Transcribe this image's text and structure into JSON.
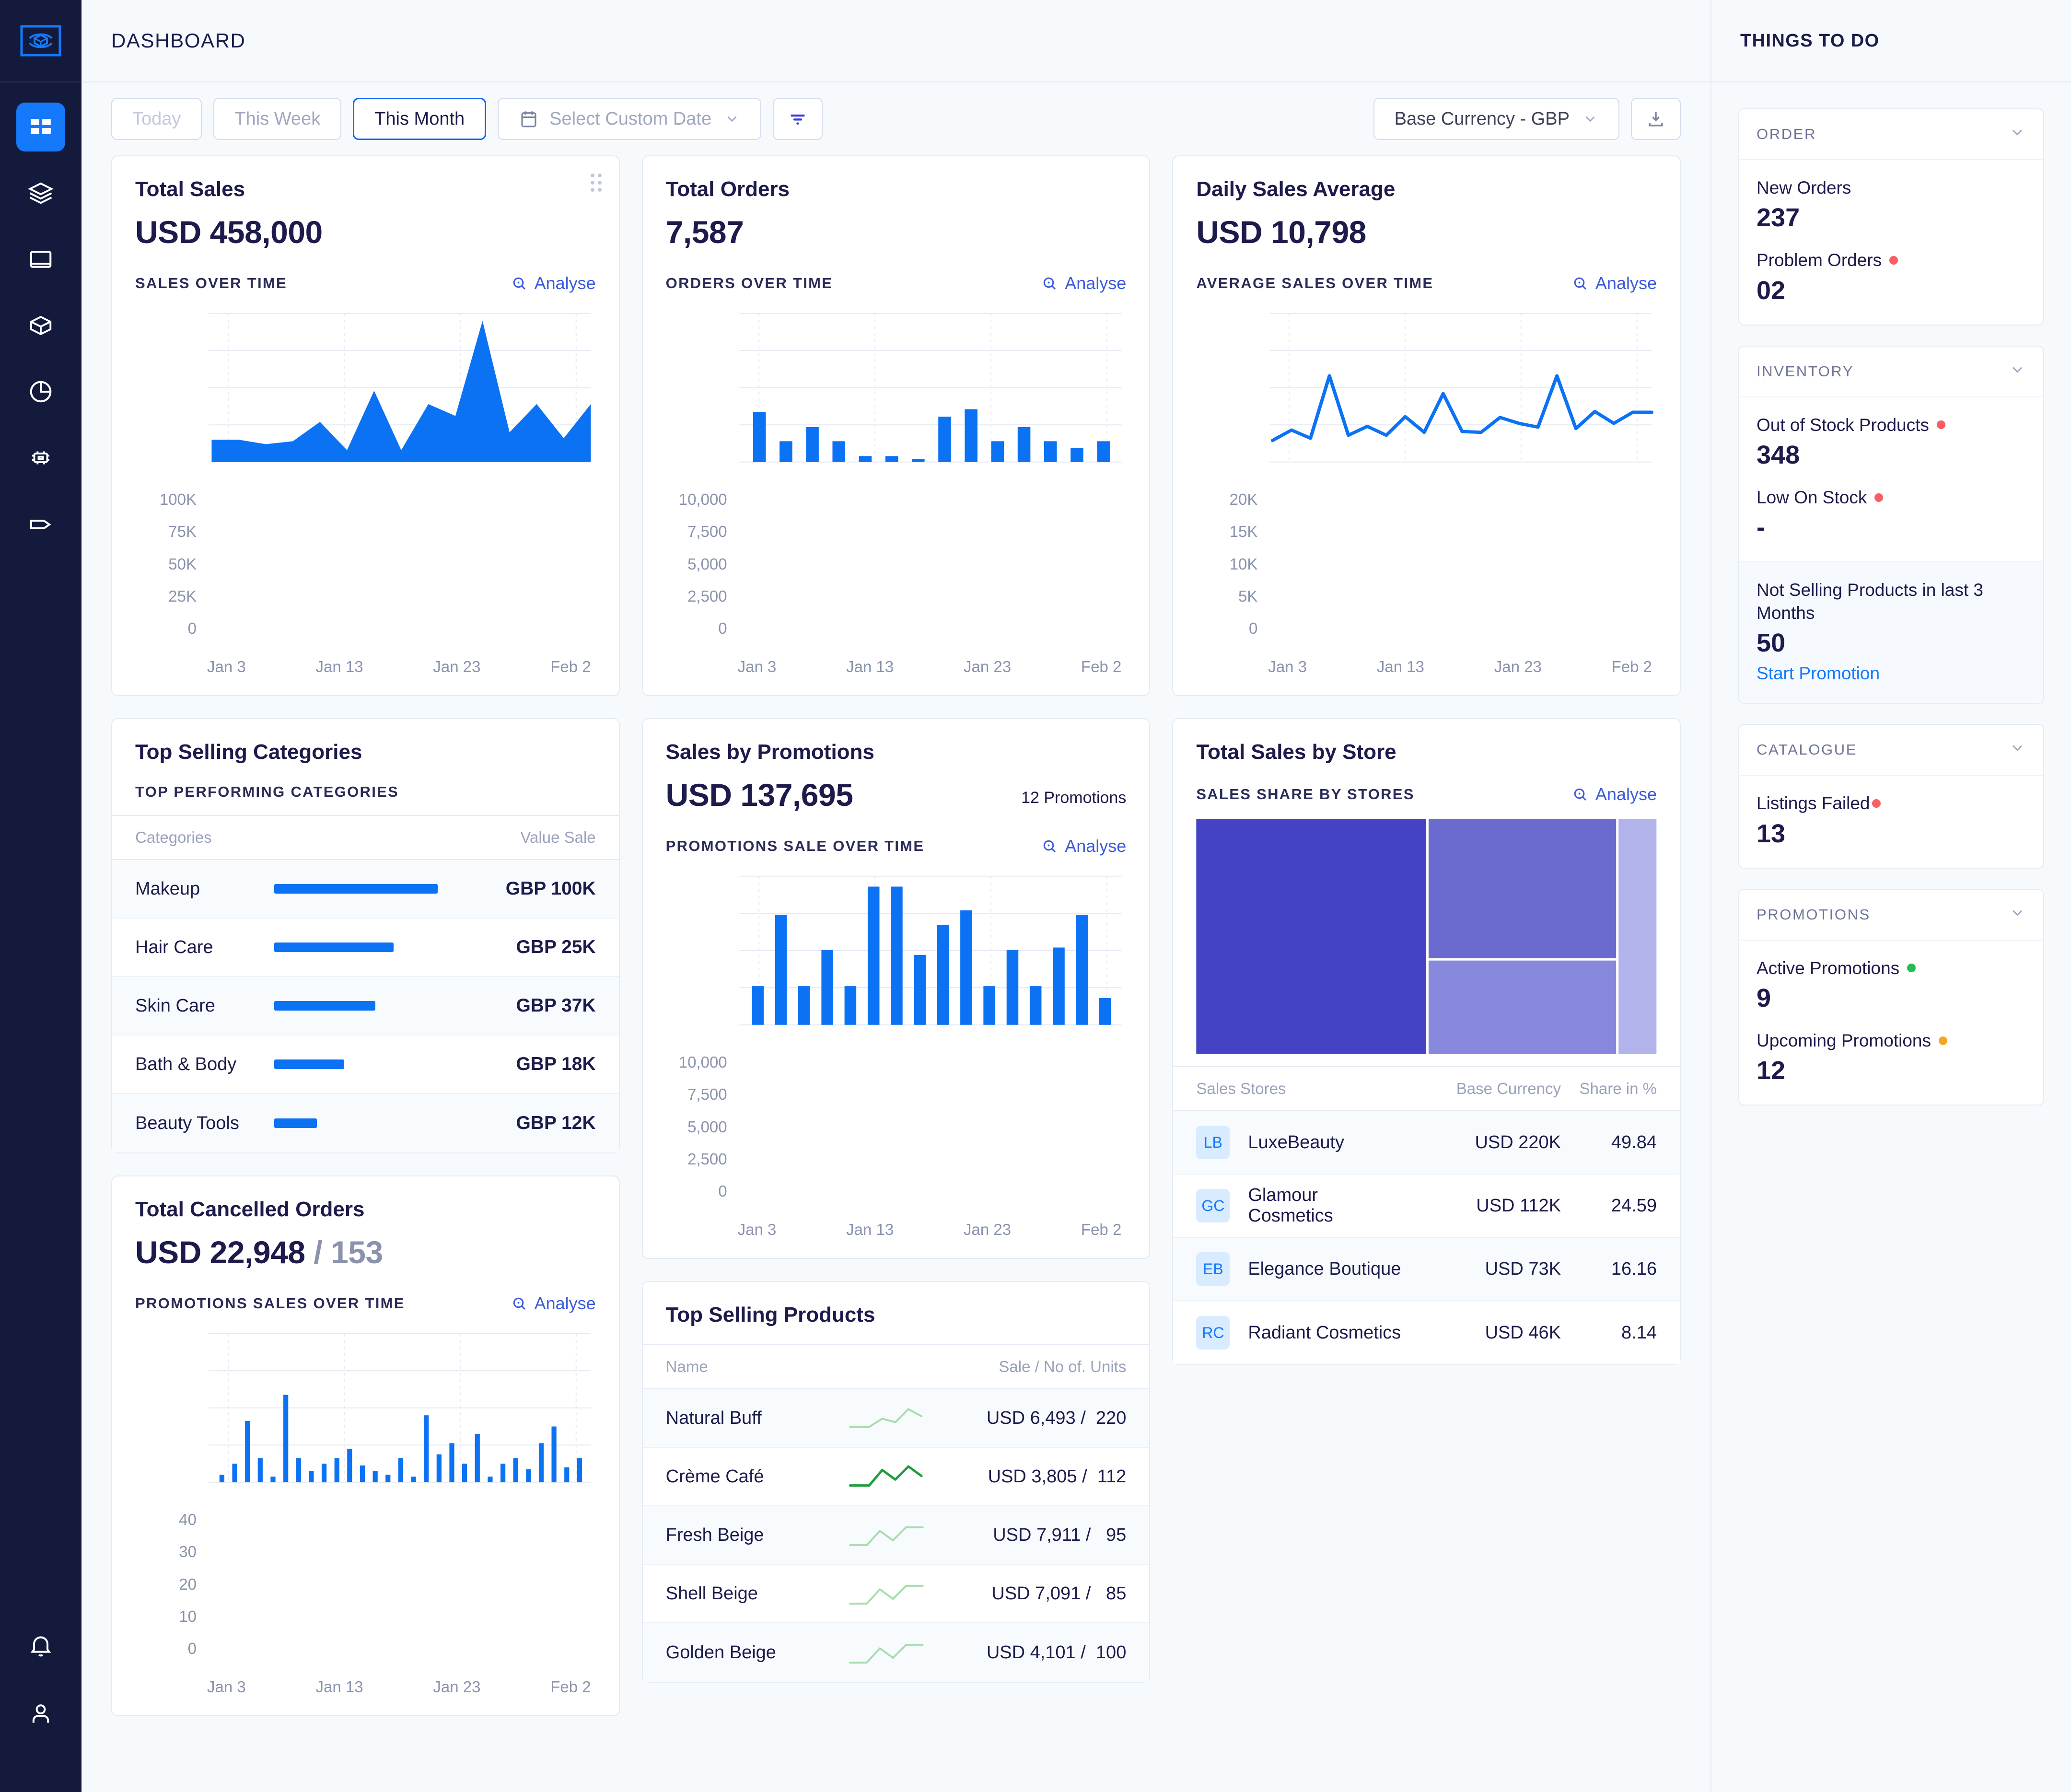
{
  "header": {
    "title": "DASHBOARD"
  },
  "sidebar": {
    "logo_icon": "cube-sync-logo-icon",
    "items": [
      {
        "name": "dashboard",
        "icon": "grid-icon",
        "active": true
      },
      {
        "name": "layers",
        "icon": "layers-icon",
        "active": false
      },
      {
        "name": "catalogue",
        "icon": "book-icon",
        "active": false
      },
      {
        "name": "products",
        "icon": "box-icon",
        "active": false
      },
      {
        "name": "analytics",
        "icon": "pie-chart-icon",
        "active": false
      },
      {
        "name": "integrations",
        "icon": "chip-icon",
        "active": false
      },
      {
        "name": "promotions",
        "icon": "tag-icon",
        "active": false
      }
    ],
    "bottom": [
      {
        "name": "notifications",
        "icon": "bell-icon"
      },
      {
        "name": "account",
        "icon": "user-icon"
      }
    ]
  },
  "toolbar": {
    "today": "Today",
    "this_week": "This Week",
    "this_month": "This Month",
    "custom_date": "Select Custom Date",
    "filter_icon": "filter-icon",
    "calendar_icon": "calendar-icon",
    "chevron_icon": "chevron-down-icon",
    "currency": "Base Currency - GBP",
    "download_icon": "download-icon"
  },
  "cards": {
    "total_sales": {
      "title": "Total Sales",
      "value": "USD 458,000",
      "sub_label": "SALES OVER TIME",
      "analyse": "Analyse"
    },
    "total_orders": {
      "title": "Total Orders",
      "value": "7,587",
      "sub_label": "ORDERS OVER TIME",
      "analyse": "Analyse"
    },
    "daily_sales_average": {
      "title": "Daily Sales Average",
      "value": "USD 10,798",
      "sub_label": "AVERAGE SALES OVER TIME",
      "analyse": "Analyse"
    },
    "top_selling_categories": {
      "title": "Top Selling Categories",
      "sub_label": "TOP PERFORMING CATEGORIES",
      "col_name": "Categories",
      "col_value": "Value Sale"
    },
    "sales_by_promotions": {
      "title": "Sales by Promotions",
      "value": "USD 137,695",
      "badge": "12 Promotions",
      "sub_label": "PROMOTIONS SALE OVER TIME",
      "analyse": "Analyse"
    },
    "total_sales_by_store": {
      "title": "Total Sales by Store",
      "sub_label": "SALES SHARE BY STORES",
      "analyse": "Analyse",
      "col_store": "Sales Stores",
      "col_currency": "Base Currency",
      "col_share": "Share in %"
    },
    "total_cancelled_orders": {
      "title": "Total Cancelled Orders",
      "value": "USD 22,948",
      "value_suffix": "/ 153",
      "sub_label": "PROMOTIONS SALES OVER TIME",
      "analyse": "Analyse"
    },
    "top_selling_products": {
      "title": "Top Selling Products",
      "col_name": "Name",
      "col_value": "Sale / No of. Units"
    }
  },
  "things_to_do": {
    "title": "THINGS TO DO",
    "panels": [
      {
        "heading": "ORDER",
        "stats": [
          {
            "label": "New Orders",
            "value": "237",
            "dot": null
          },
          {
            "label": "Problem Orders",
            "value": "02",
            "dot": "#FB5E62"
          }
        ]
      },
      {
        "heading": "INVENTORY",
        "stats": [
          {
            "label": "Out of Stock Products",
            "value": "348",
            "dot": "#FB5E62"
          },
          {
            "label": "Low On Stock",
            "value": "-",
            "dot": "#FB5E62"
          }
        ],
        "highlight": {
          "label": "Not Selling Products in last 3 Months",
          "value": "50",
          "link": "Start Promotion"
        }
      },
      {
        "heading": "CATALOGUE",
        "stats": [
          {
            "label": "Listings Failed",
            "value": "13",
            "dot": "#FB5E62",
            "tight": true
          }
        ]
      },
      {
        "heading": "PROMOTIONS",
        "stats": [
          {
            "label": "Active Promotions",
            "value": "9",
            "dot": "#21BF50"
          },
          {
            "label": "Upcoming Promotions",
            "value": "12",
            "dot": "#F5A623"
          }
        ]
      }
    ]
  },
  "colors": {
    "accent_blue": "#0B72F4",
    "sidebar_bg": "#141A3C",
    "active_nav": "#1479FA",
    "treemap": [
      "#4343C4",
      "#6A6ACF",
      "#8787DB",
      "#B3B3EB"
    ],
    "sparkline_green": "#A8DCAE",
    "sparkline_green_strong": "#1E9E3E",
    "text_dark": "#1D1B4B"
  },
  "chart_data": [
    {
      "id": "sales_over_time",
      "type": "area",
      "title": "SALES OVER TIME",
      "xlabel": "",
      "ylabel": "",
      "ylim": [
        0,
        100000
      ],
      "yticks": [
        "0",
        "25K",
        "50K",
        "75K",
        "100K"
      ],
      "xticks": [
        "Jan 3",
        "Jan 13",
        "Jan 23",
        "Feb 2"
      ],
      "grid": true,
      "values": [
        15000,
        15000,
        12000,
        14000,
        27000,
        8000,
        48000,
        8000,
        39000,
        31000,
        95000,
        20000,
        39000,
        16000,
        39000
      ]
    },
    {
      "id": "orders_over_time",
      "type": "bar",
      "title": "ORDERS OVER TIME",
      "ylim": [
        0,
        10000
      ],
      "yticks": [
        "0",
        "2,500",
        "5,000",
        "7,500",
        "10,000"
      ],
      "xticks": [
        "Jan 3",
        "Jan 13",
        "Jan 23",
        "Feb 2"
      ],
      "grid": true,
      "values": [
        3350,
        1400,
        2350,
        1400,
        400,
        400,
        200,
        3050,
        3550,
        1400,
        2350,
        1400,
        950,
        1400
      ]
    },
    {
      "id": "average_sales_over_time",
      "type": "line",
      "title": "AVERAGE SALES OVER TIME",
      "ylim": [
        0,
        20000
      ],
      "yticks": [
        "0",
        "5K",
        "10K",
        "15K",
        "20K"
      ],
      "xticks": [
        "Jan 3",
        "Jan 13",
        "Jan 23",
        "Feb 2"
      ],
      "grid": true,
      "values": [
        2900,
        4300,
        3200,
        11600,
        3600,
        4800,
        3600,
        6100,
        4000,
        9200,
        4100,
        4000,
        6000,
        5200,
        4700,
        11600,
        4500,
        6800,
        5200,
        6700,
        6700
      ]
    },
    {
      "id": "top_performing_categories",
      "type": "bar",
      "title": "TOP PERFORMING CATEGORIES",
      "orientation": "horizontal",
      "categories": [
        "Makeup",
        "Hair Care",
        "Skin Care",
        "Bath & Body",
        "Beauty Tools"
      ],
      "values": [
        "GBP 100K",
        "GBP 25K",
        "GBP 37K",
        "GBP 18K",
        "GBP 12K"
      ],
      "bar_pct": [
        100,
        73,
        62,
        43,
        26
      ]
    },
    {
      "id": "promotions_sale_over_time",
      "type": "bar",
      "title": "PROMOTIONS SALE OVER TIME",
      "ylim": [
        0,
        10000
      ],
      "yticks": [
        "0",
        "2,500",
        "5,000",
        "7,500",
        "10,000"
      ],
      "xticks": [
        "Jan 3",
        "Jan 13",
        "Jan 23",
        "Feb 2"
      ],
      "grid": true,
      "values": [
        2600,
        7400,
        2600,
        5050,
        2600,
        9300,
        9300,
        4700,
        6700,
        7700,
        2600,
        5050,
        2600,
        5200,
        7400,
        1800
      ]
    },
    {
      "id": "sales_share_by_stores",
      "type": "treemap",
      "title": "SALES SHARE BY STORES",
      "labels": [
        "LuxeBeauty",
        "Glamour Cosmetics",
        "Elegance Boutique",
        "Radiant Cosmetics"
      ],
      "values": [
        49.84,
        24.59,
        16.16,
        8.14
      ]
    },
    {
      "id": "cancelled_orders_over_time",
      "type": "bar",
      "title": "PROMOTIONS SALES OVER TIME",
      "ylim": [
        0,
        40
      ],
      "yticks": [
        "0",
        "10",
        "20",
        "30",
        "40"
      ],
      "xticks": [
        "Jan 3",
        "Jan 13",
        "Jan 23",
        "Feb 2"
      ],
      "grid": true,
      "values": [
        2,
        5,
        16.5,
        6.5,
        1.5,
        23.5,
        6.5,
        3,
        5,
        6.5,
        9,
        4.5,
        3,
        2,
        6.5,
        1.5,
        18,
        7.5,
        10.5,
        5,
        13,
        1.5,
        5,
        6.5,
        3.5,
        10.5,
        15,
        4,
        6.5
      ]
    }
  ],
  "tables": {
    "categories": [
      {
        "name": "Makeup",
        "value": "GBP 100K",
        "pct": 100
      },
      {
        "name": "Hair Care",
        "value": "GBP 25K",
        "pct": 73
      },
      {
        "name": "Skin Care",
        "value": "GBP 37K",
        "pct": 62
      },
      {
        "name": "Bath & Body",
        "value": "GBP 18K",
        "pct": 43
      },
      {
        "name": "Beauty Tools",
        "value": "GBP 12K",
        "pct": 26
      }
    ],
    "stores": [
      {
        "initials": "LB",
        "name": "LuxeBeauty",
        "currency": "USD 220K",
        "share": "49.84"
      },
      {
        "initials": "GC",
        "name": "Glamour Cosmetics",
        "currency": "USD 112K",
        "share": "24.59"
      },
      {
        "initials": "EB",
        "name": "Elegance Boutique",
        "currency": "USD 73K",
        "share": "16.16"
      },
      {
        "initials": "RC",
        "name": "Radiant Cosmetics",
        "currency": "USD 46K",
        "share": "8.14"
      }
    ],
    "products": [
      {
        "name": "Natural Buff",
        "value": "USD 6,493 /  220",
        "strong": false
      },
      {
        "name": "Crème Café",
        "value": "USD 3,805 /  112",
        "strong": true
      },
      {
        "name": "Fresh Beige",
        "value": "USD 7,911 /   95",
        "strong": false
      },
      {
        "name": "Shell Beige",
        "value": "USD 7,091 /   85",
        "strong": false
      },
      {
        "name": "Golden Beige",
        "value": "USD 4,101 /  100",
        "strong": false
      }
    ]
  }
}
